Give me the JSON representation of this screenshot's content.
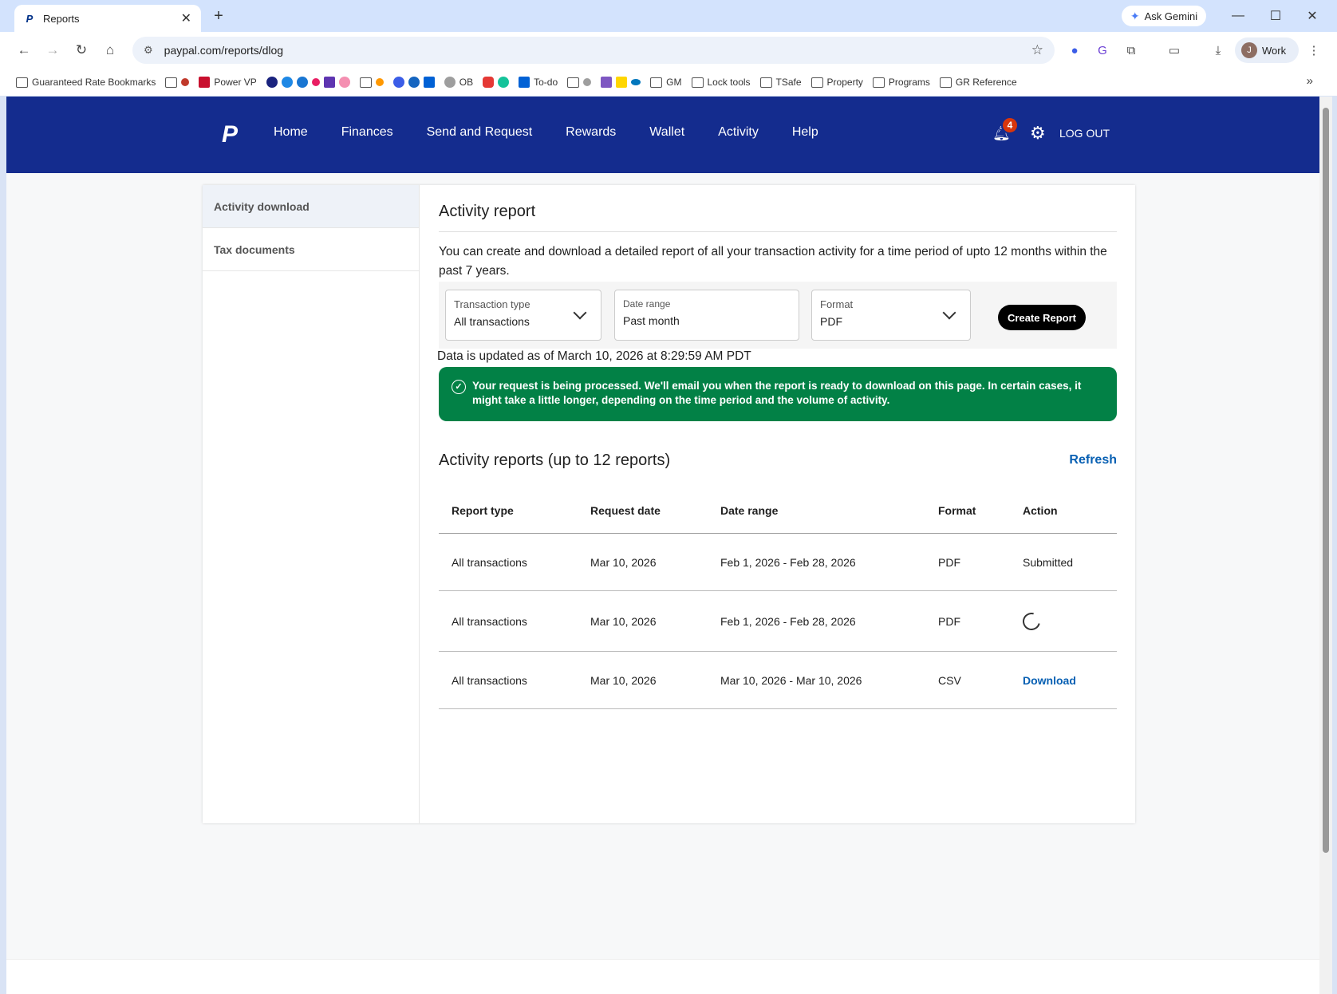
{
  "browser": {
    "tab_title": "Reports",
    "tab_icon": "P",
    "ask_gemini": "Ask Gemini",
    "url": "paypal.com/reports/dlog",
    "profile_initial": "J",
    "profile_name": "Work",
    "bookmarks": [
      {
        "label": "Guaranteed Rate Bookmarks",
        "icon": "folder-icon"
      },
      {
        "label": "",
        "icon": "folder-icon"
      },
      {
        "label": "Power VP",
        "icon": "bookmark-icon"
      },
      {
        "label": "OB",
        "icon": "site-icon"
      },
      {
        "label": "To-do",
        "icon": "box-icon"
      },
      {
        "label": "GM",
        "icon": "folder-icon"
      },
      {
        "label": "Lock tools",
        "icon": "folder-icon"
      },
      {
        "label": "TSafe",
        "icon": "folder-icon"
      },
      {
        "label": "Property",
        "icon": "folder-icon"
      },
      {
        "label": "Programs",
        "icon": "folder-icon"
      },
      {
        "label": "GR Reference",
        "icon": "folder-icon"
      }
    ]
  },
  "nav": {
    "links": [
      "Home",
      "Finances",
      "Send and Request",
      "Rewards",
      "Wallet",
      "Activity",
      "Help"
    ],
    "notification_count": "4",
    "logout": "LOG OUT"
  },
  "sidebar": {
    "items": [
      {
        "label": "Activity download",
        "active": true
      },
      {
        "label": "Tax documents",
        "active": false
      }
    ]
  },
  "report": {
    "title": "Activity report",
    "intro": "You can create and download a detailed report of all your transaction activity for a time period of upto 12 months within the past 7 years.",
    "transaction_type_label": "Transaction type",
    "transaction_type_value": "All transactions",
    "date_range_label": "Date range",
    "date_range_value": "Past month",
    "format_label": "Format",
    "format_value": "PDF",
    "create_button": "Create Report",
    "updated_text": "Data is updated as of March 10, 2026 at 8:29:59 AM PDT",
    "alert_text": "Your request is being processed. We'll email you when the report is ready to download on this page. In certain cases, it might take a little longer, depending on the time period and the volume of activity."
  },
  "reports_list": {
    "title": "Activity reports (up to 12 reports)",
    "refresh": "Refresh",
    "columns": [
      "Report type",
      "Request date",
      "Date range",
      "Format",
      "Action"
    ],
    "rows": [
      {
        "type": "All transactions",
        "request_date": "Mar 10, 2026",
        "date_range": "Feb 1, 2026 - Feb 28, 2026",
        "format": "PDF",
        "action": "Submitted"
      },
      {
        "type": "All transactions",
        "request_date": "Mar 10, 2026",
        "date_range": "Feb 1, 2026 - Feb 28, 2026",
        "format": "PDF",
        "action": ""
      },
      {
        "type": "All transactions",
        "request_date": "Mar 10, 2026",
        "date_range": "Mar 10, 2026 - Mar 10, 2026",
        "format": "CSV",
        "action": "Download"
      }
    ]
  },
  "colors": {
    "nav_bg": "#142c8e",
    "alert_bg": "#028146",
    "link": "#0860b3",
    "badge": "#d9360b"
  }
}
